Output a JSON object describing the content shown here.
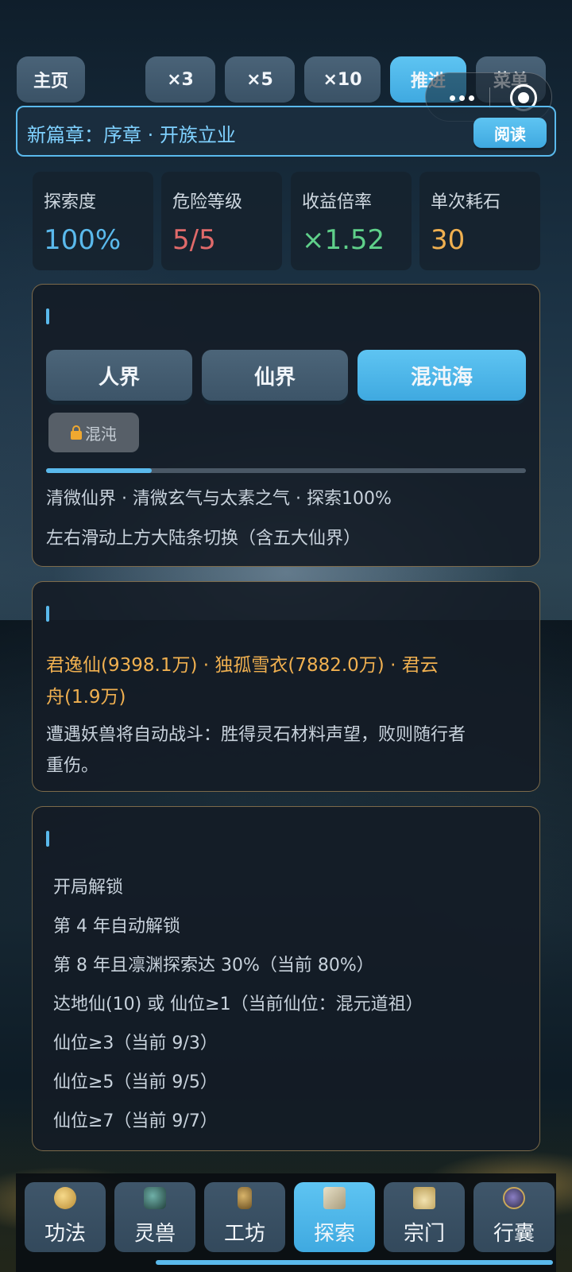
{
  "top_bar": {
    "home": "主页",
    "x3": "×3",
    "x5": "×5",
    "x10": "×10",
    "advance": "推进",
    "menu": "菜单"
  },
  "chapter": {
    "title": "新篇章：序章 · 开族立业",
    "read": "阅读"
  },
  "stats": [
    {
      "label": "探索度",
      "value": "100%",
      "color": "#5ab9ec"
    },
    {
      "label": "危险等级",
      "value": "5/5",
      "color": "#e06a6a"
    },
    {
      "label": "收益倍率",
      "value": "×1.52",
      "color": "#5fd08a"
    },
    {
      "label": "单次耗石",
      "value": "30",
      "color": "#f0b050"
    }
  ],
  "realm_panel": {
    "tabs": [
      "人界",
      "仙界",
      "混沌海"
    ],
    "active_tab": "混沌海",
    "locked": "混沌",
    "progress": 0.22,
    "info": "清微仙界 · 清微玄气与太素之气 · 探索100%",
    "hint": "左右滑动上方大陆条切换（含五大仙界）"
  },
  "companions_panel": {
    "names_line1": "君逸仙(9398.1万) · 独孤雪衣(7882.0万) · 君云",
    "names_line2": "舟(1.9万)",
    "note_line1": "遭遇妖兽将自动战斗：胜得灵石材料声望，败则随行者",
    "note_line2": "重伤。"
  },
  "unlock_panel": {
    "items": [
      "开局解锁",
      "第 4 年自动解锁",
      "第 8 年且凛渊探索达 30%（当前 80%）",
      "达地仙(10) 或 仙位≥1（当前仙位：混元道祖）",
      "仙位≥3（当前 9/3）",
      "仙位≥5（当前 9/5）",
      "仙位≥7（当前 9/7）"
    ]
  },
  "bottom_nav": {
    "tabs": [
      {
        "label": "功法",
        "icon": "gold-mask-icon"
      },
      {
        "label": "灵兽",
        "icon": "beast-icon"
      },
      {
        "label": "工坊",
        "icon": "furnace-icon"
      },
      {
        "label": "探索",
        "icon": "scroll-map-icon"
      },
      {
        "label": "宗门",
        "icon": "temple-icon"
      },
      {
        "label": "行囊",
        "icon": "bag-icon"
      }
    ],
    "active": "探索"
  },
  "colors": {
    "accent": "#5ab9ec",
    "danger": "#e06a6a",
    "gain": "#5fd08a",
    "cost": "#f0b050",
    "gold_text": "#f0b050"
  }
}
